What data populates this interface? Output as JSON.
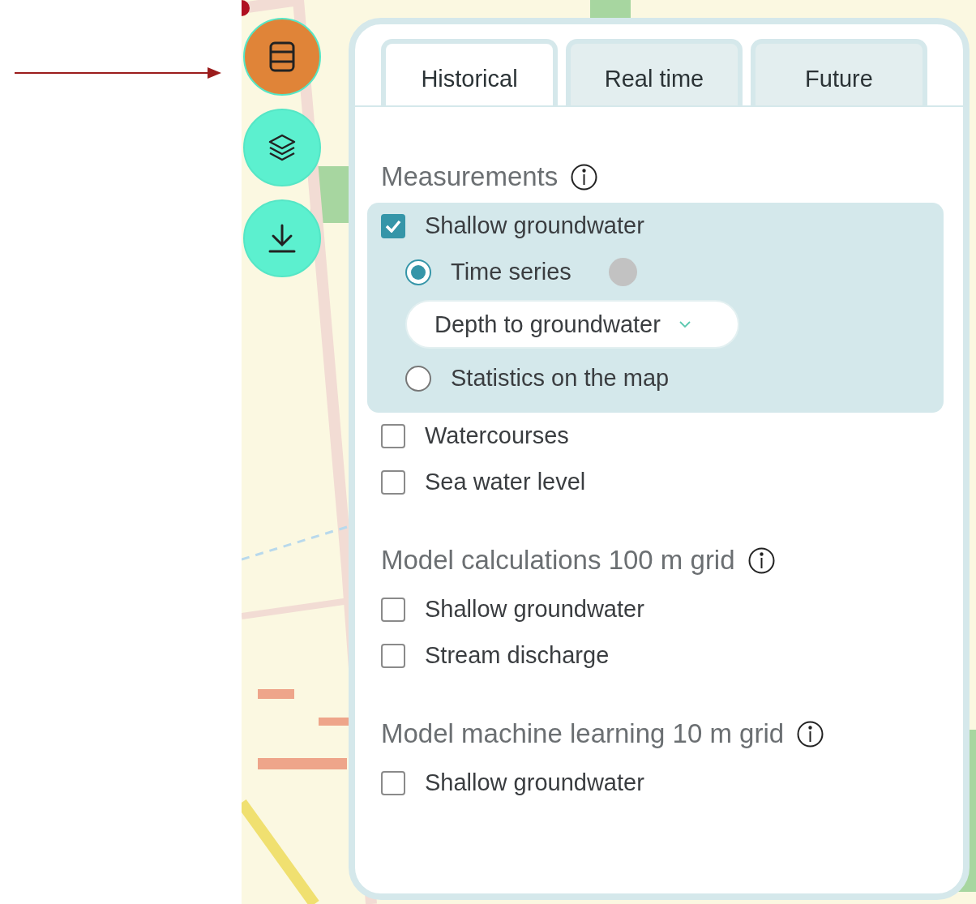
{
  "side_buttons": [
    {
      "kind": "database",
      "selected": true
    },
    {
      "kind": "layers",
      "selected": false
    },
    {
      "kind": "download",
      "selected": false
    }
  ],
  "tabs": [
    {
      "label": "Historical",
      "selected": true
    },
    {
      "label": "Real time",
      "selected": false
    },
    {
      "label": "Future",
      "selected": false
    }
  ],
  "sections": [
    {
      "title": "Measurements",
      "items": [
        {
          "label": "Shallow groundwater",
          "checked": true,
          "expanded": true,
          "options": [
            {
              "label": "Time series",
              "selected": true,
              "dropdown": {
                "value": "Depth to groundwater"
              }
            },
            {
              "label": "Statistics on the map",
              "selected": false
            }
          ]
        },
        {
          "label": "Watercourses",
          "checked": false,
          "expanded": false
        },
        {
          "label": "Sea water level",
          "checked": false,
          "expanded": false
        }
      ]
    },
    {
      "title": "Model calculations 100 m grid",
      "items": [
        {
          "label": "Shallow groundwater",
          "checked": false,
          "expanded": false
        },
        {
          "label": "Stream discharge",
          "checked": false,
          "expanded": false
        }
      ]
    },
    {
      "title": "Model machine learning 10 m grid",
      "items": [
        {
          "label": "Shallow groundwater",
          "checked": false,
          "expanded": false
        }
      ]
    }
  ]
}
